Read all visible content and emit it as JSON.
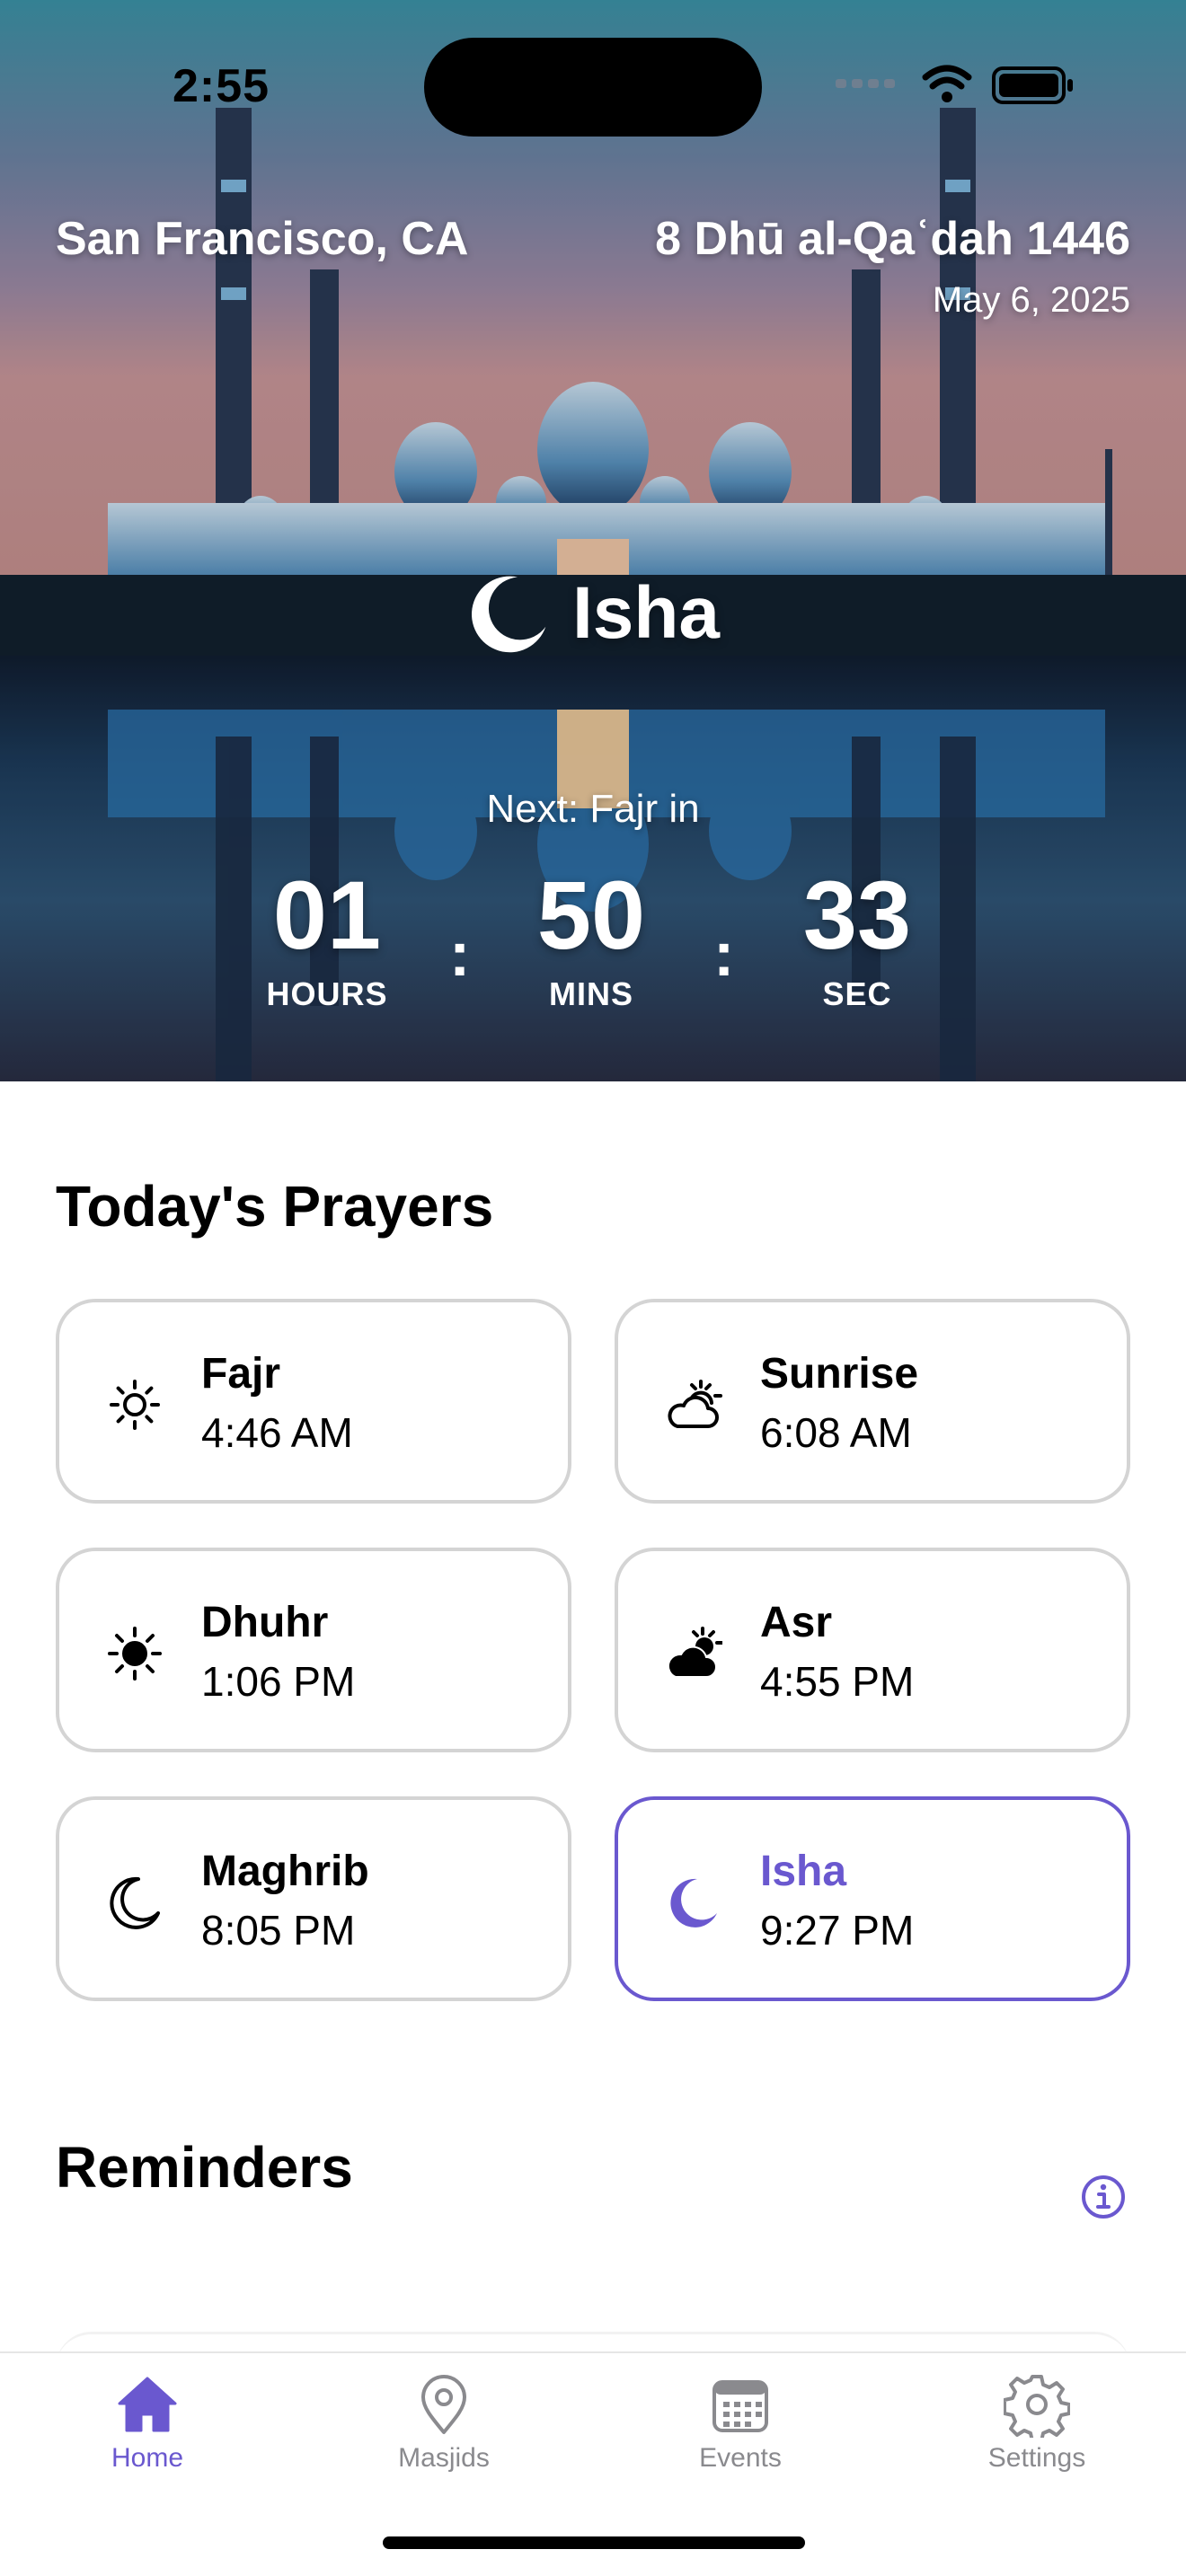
{
  "status_bar": {
    "time": "2:55"
  },
  "header": {
    "location": "San Francisco, CA",
    "hijri_date": "8 Dhū al-Qaʿdah 1446",
    "gregorian_date": "May 6, 2025"
  },
  "current_prayer": {
    "name": "Isha",
    "icon": "moon-icon"
  },
  "next_prayer": {
    "label": "Next: Fajr in",
    "hours": "01",
    "hours_label": "HOURS",
    "mins": "50",
    "mins_label": "MINS",
    "secs": "33",
    "secs_label": "SEC",
    "separator": ":"
  },
  "prayers_section": {
    "title": "Today's Prayers",
    "items": [
      {
        "name": "Fajr",
        "time": "4:46 AM",
        "icon": "sun-outline-icon",
        "active": false
      },
      {
        "name": "Sunrise",
        "time": "6:08 AM",
        "icon": "sun-cloud-outline-icon",
        "active": false
      },
      {
        "name": "Dhuhr",
        "time": "1:06 PM",
        "icon": "sun-filled-icon",
        "active": false
      },
      {
        "name": "Asr",
        "time": "4:55 PM",
        "icon": "sun-cloud-filled-icon",
        "active": false
      },
      {
        "name": "Maghrib",
        "time": "8:05 PM",
        "icon": "moon-outline-icon",
        "active": false
      },
      {
        "name": "Isha",
        "time": "9:27 PM",
        "icon": "moon-filled-icon",
        "active": true
      }
    ]
  },
  "reminders_section": {
    "title": "Reminders",
    "info_icon": "info-icon"
  },
  "tab_bar": {
    "items": [
      {
        "label": "Home",
        "icon": "home-icon",
        "active": true
      },
      {
        "label": "Masjids",
        "icon": "map-pin-icon",
        "active": false
      },
      {
        "label": "Events",
        "icon": "calendar-icon",
        "active": false
      },
      {
        "label": "Settings",
        "icon": "gear-icon",
        "active": false
      }
    ]
  },
  "colors": {
    "accent": "#6a58cf",
    "card_border": "#d4d4d4",
    "tab_inactive": "#8a8a8e"
  }
}
